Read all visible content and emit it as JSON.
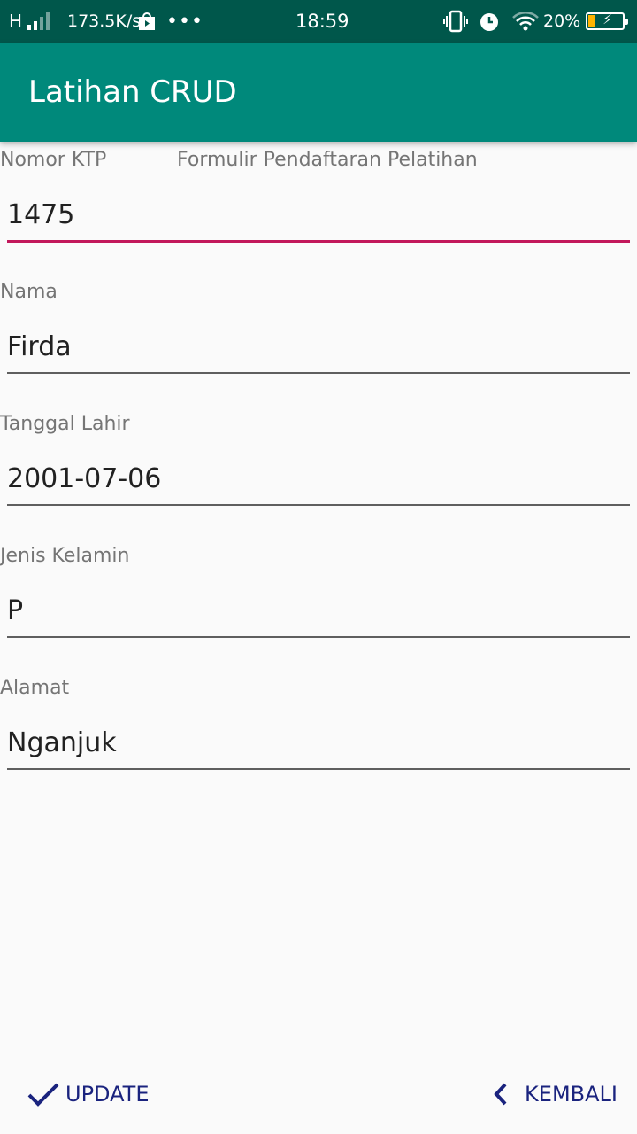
{
  "status_bar": {
    "network": "H",
    "speed": "173.5K/s",
    "more": "•••",
    "time": "18:59",
    "battery": "20%"
  },
  "app_bar": {
    "title": "Latihan CRUD"
  },
  "form": {
    "heading": "Formulir Pendaftaran Pelatihan",
    "fields": [
      {
        "label": "Nomor KTP",
        "value": "1475"
      },
      {
        "label": "Nama",
        "value": "Firda"
      },
      {
        "label": "Tanggal Lahir",
        "value": "2001-07-06"
      },
      {
        "label": "Jenis Kelamin",
        "value": "P"
      },
      {
        "label": "Alamat",
        "value": "Nganjuk"
      }
    ]
  },
  "actions": {
    "update_label": "UPDATE",
    "back_label": "KEMBALI"
  },
  "colors": {
    "status_bar": "#00574b",
    "app_bar": "#00897b",
    "focus_underline": "#c2185b",
    "button_text": "#1a237e"
  },
  "icons": {
    "signal": "signal-icon",
    "store": "play-store-icon",
    "vibrate": "vibrate-icon",
    "alarm": "alarm-icon",
    "wifi": "wifi-icon",
    "battery": "battery-icon",
    "update": "check-icon",
    "back": "chevron-left-icon"
  }
}
